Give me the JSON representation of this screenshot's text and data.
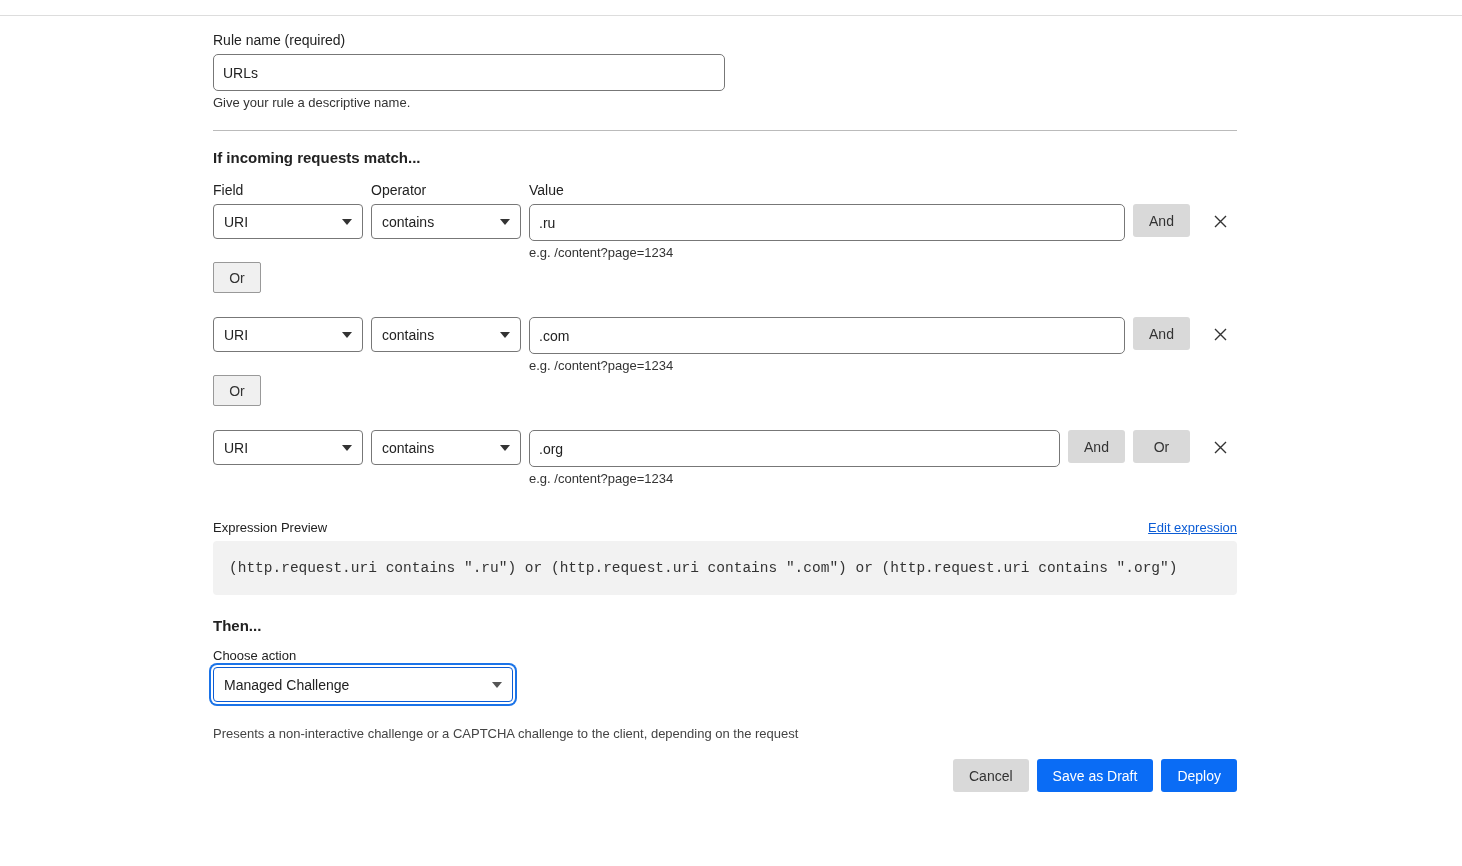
{
  "rule_name": {
    "label": "Rule name (required)",
    "value": "URLs",
    "help": "Give your rule a descriptive name."
  },
  "match": {
    "heading": "If incoming requests match...",
    "columns": [
      "Field",
      "Operator",
      "Value"
    ],
    "conditions": [
      {
        "field": "URI",
        "operator": "contains",
        "value": ".ru",
        "hint": "e.g. /content?page=1234",
        "buttons": [
          "And"
        ],
        "below_button": "Or"
      },
      {
        "field": "URI",
        "operator": "contains",
        "value": ".com",
        "hint": "e.g. /content?page=1234",
        "buttons": [
          "And"
        ],
        "below_button": "Or"
      },
      {
        "field": "URI",
        "operator": "contains",
        "value": ".org",
        "hint": "e.g. /content?page=1234",
        "buttons": [
          "And",
          "Or"
        ]
      }
    ]
  },
  "expression": {
    "label": "Expression Preview",
    "edit_link": "Edit expression",
    "code": "(http.request.uri contains \".ru\") or (http.request.uri contains \".com\") or (http.request.uri contains \".org\")"
  },
  "then": {
    "heading": "Then...",
    "label": "Choose action",
    "value": "Managed Challenge",
    "focused": true,
    "description": "Presents a non-interactive challenge or a CAPTCHA challenge to the client, depending on the request"
  },
  "actions": [
    {
      "label": "Cancel",
      "kind": "secondary"
    },
    {
      "label": "Save as Draft",
      "kind": "primary"
    },
    {
      "label": "Deploy",
      "kind": "primary"
    }
  ]
}
